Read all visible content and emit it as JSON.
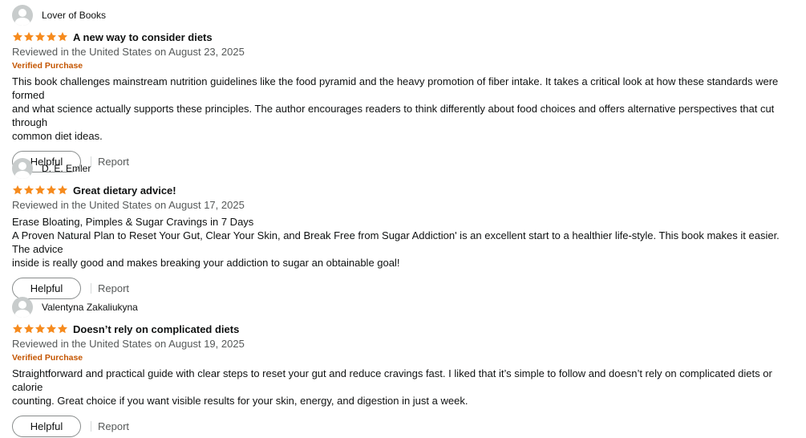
{
  "icons": {
    "avatar": "default-user-avatar-icon",
    "star": "filled-star-icon"
  },
  "colors": {
    "star": "#f68b1e",
    "verified": "#c45500",
    "muted_text": "#565959",
    "text": "#0f1111",
    "avatar_bg": "#c8cccc"
  },
  "reviews": [
    {
      "reviewer": "Lover of Books",
      "rating": 5,
      "title": "A new way to consider diets",
      "date": "Reviewed in the United States on August 23, 2025",
      "verified": "Verified Purchase",
      "body_lines": [
        "This book challenges mainstream nutrition guidelines like the food pyramid and the heavy promotion of fiber intake. It takes a critical look at how these standards were formed",
        "and what science actually supports these principles. The author encourages readers to think differently about food choices and offers alternative perspectives that cut through",
        "common diet ideas."
      ],
      "helpful_label": "Helpful",
      "report_label": "Report"
    },
    {
      "reviewer": "D. E. Emler",
      "rating": 5,
      "title": "Great dietary advice!",
      "date": "Reviewed in the United States on August 17, 2025",
      "verified": "",
      "body_lines": [
        "Erase Bloating, Pimples & Sugar Cravings in 7 Days",
        "A Proven Natural Plan to Reset Your Gut, Clear Your Skin, and Break Free from Sugar Addiction' is an excellent start to a healthier life-style. This book makes it easier. The advice",
        "inside is really good and makes breaking your addiction to sugar an obtainable goal!"
      ],
      "helpful_label": "Helpful",
      "report_label": "Report"
    },
    {
      "reviewer": "Valentyna Zakaliukyna",
      "rating": 5,
      "title": "Doesn’t rely on complicated diets",
      "date": "Reviewed in the United States on August 19, 2025",
      "verified": "Verified Purchase",
      "body_lines": [
        "Straightforward and practical guide with clear steps to reset your gut and reduce cravings fast. I liked that it’s simple to follow and doesn’t rely on complicated diets or calorie",
        "counting. Great choice if you want visible results for your skin, energy, and digestion in just a week."
      ],
      "helpful_label": "Helpful",
      "report_label": "Report"
    }
  ]
}
